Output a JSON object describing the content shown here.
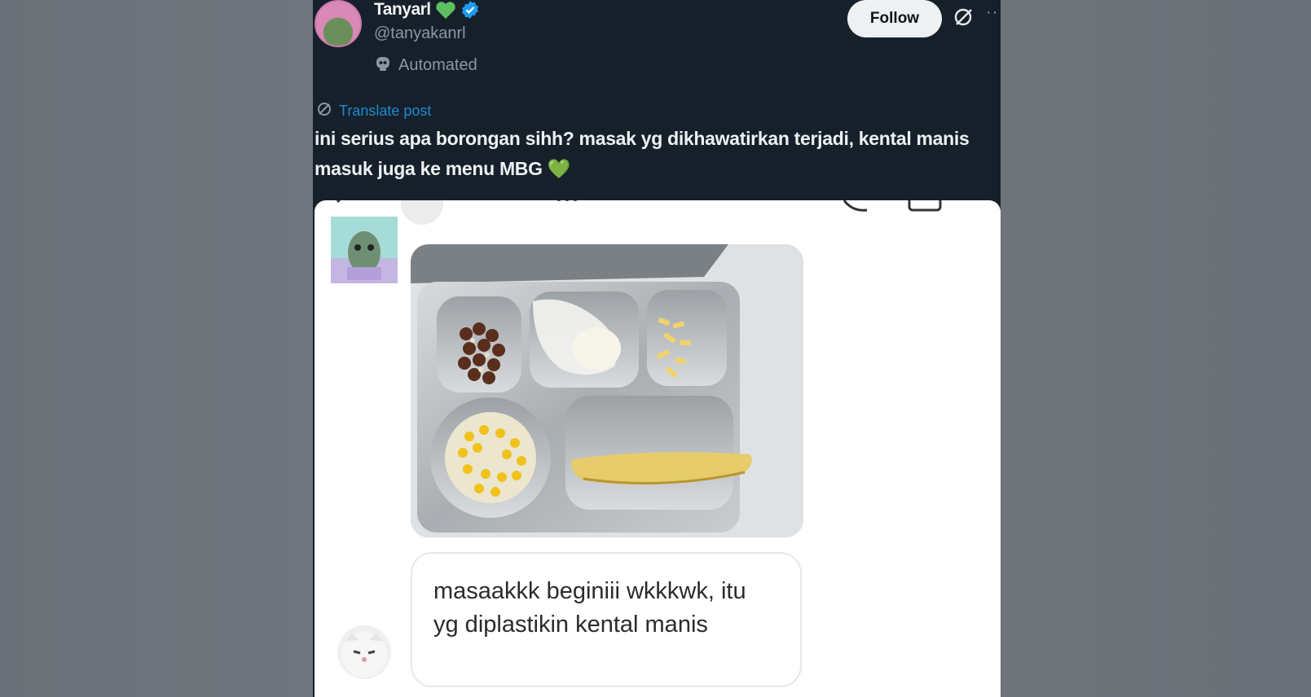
{
  "author": {
    "display_name": "Tanyarl",
    "handle": "@tanyakanrl",
    "label": "Automated"
  },
  "actions": {
    "follow_label": "Follow"
  },
  "post": {
    "translate_label": "Translate post",
    "text": "ini serius apa borongan sihh? masak yg dikhawatirkan terjadi, kental manis masuk juga ke menu MBG 💚"
  },
  "media": {
    "chat_message": "masaakkk beginiii wkkkwk, itu yg diplastikin kental manis"
  },
  "colors": {
    "accent_link": "#1d8ad6",
    "heart_green": "#5cbf60",
    "verified_blue": "#1d9bf0"
  },
  "icons": [
    "green-heart-icon",
    "verified-badge-icon",
    "robot-icon",
    "grok-icon",
    "more-icon",
    "translate-icon"
  ]
}
